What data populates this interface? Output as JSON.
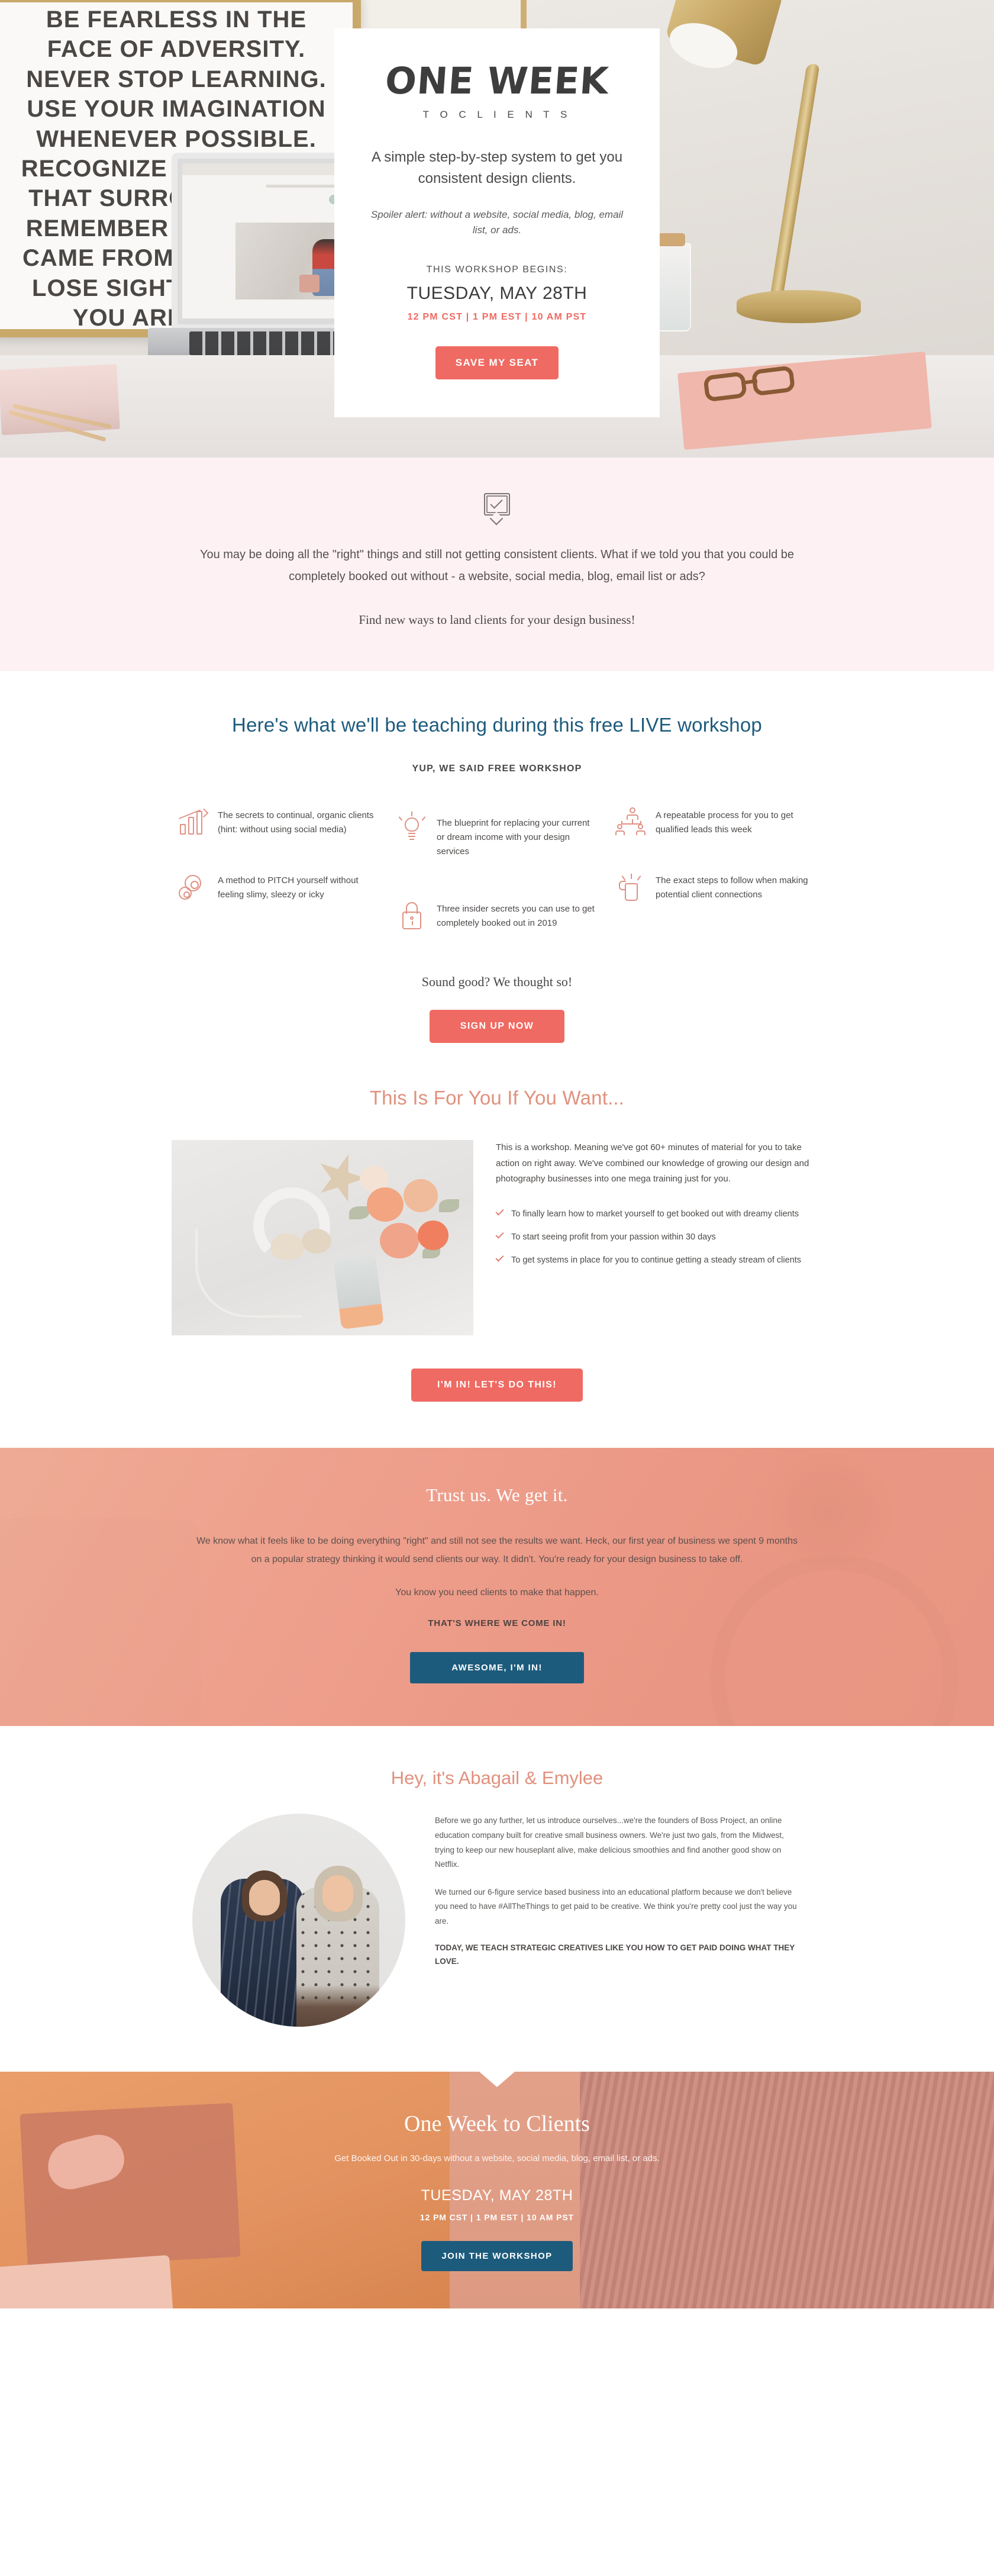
{
  "hero": {
    "poster_quote": "BE FEARLESS IN THE\nFACE OF ADVERSITY.\nNEVER STOP LEARNING.\nUSE YOUR IMAGINATION\nWHENEVER POSSIBLE.\nRECOGNIZE THE BEAUTY\nTHAT SURROUNDS YOU.\nREMEMBER WHERE YOU\nCAME FROM, BUT NEVER\nLOSE SIGHT OF WHERE\nYOU ARE GOING.",
    "logo_main": "ONE WEEK",
    "logo_sub": "T O   C L I E N T S",
    "tagline": "A simple step-by-step system to get you consistent design clients.",
    "spoiler": "Spoiler alert: without a website, social media, blog, email list, or ads.",
    "begins_label": "THIS WORKSHOP BEGINS:",
    "date": "TUESDAY, MAY 28TH",
    "times": "12 PM CST  |  1 PM EST  |  10 AM PST",
    "cta_label": "SAVE MY SEAT"
  },
  "pink_intro": {
    "icon": "chat-check-icon",
    "lead": "You may be doing all the \"right\" things and still not getting consistent clients. What if we told you that you could be completely booked out without - a website, social media, blog, email list or ads?",
    "serif_line": "Find new ways to land clients for your design business!"
  },
  "teaching": {
    "heading": "Here's what we'll be teaching during this free LIVE workshop",
    "kicker": "YUP, WE SAID FREE WORKSHOP",
    "features": [
      {
        "icon": "chart-growth-icon",
        "text": "The secrets to continual, organic clients (hint: without using social media)"
      },
      {
        "icon": "lightbulb-icon",
        "text": "The blueprint for replacing your current or dream income with your design services"
      },
      {
        "icon": "people-network-icon",
        "text": "A repeatable process for you to get qualified leads this week"
      },
      {
        "icon": "gears-icon",
        "text": "A method to PITCH yourself without feeling slimy, sleezy or icky"
      },
      {
        "icon": "lock-icon",
        "text": "Three insider secrets you can use to get completely booked out in 2019"
      },
      {
        "icon": "thumbs-up-icon",
        "text": "The exact steps to follow when making potential client connections"
      }
    ],
    "sound_good": "Sound good? We thought so!",
    "cta_label": "SIGN UP NOW"
  },
  "for_you": {
    "heading": "This Is For You If You Want...",
    "photo_alt": "headphones-roses-phone-flatlay",
    "paragraph": "This is a workshop. Meaning we've got 60+ minutes of material for you to take action on right away. We've combined our knowledge of growing our design and photography businesses into one mega training just for you.",
    "bullets": [
      "To finally learn how to market yourself to get booked out with dreamy clients",
      "To start seeing profit from your passion within 30 days",
      "To get systems in place for you to continue getting a steady stream of clients"
    ],
    "cta_label": "I'M IN! LET'S DO THIS!"
  },
  "trust": {
    "heading": "Trust us. We get it.",
    "body": "We know what it feels like to be doing everything \"right\" and still not see the results we want. Heck, our first year of business we spent 9 months on a popular strategy thinking it would send clients our way. It didn't. You're ready for your design business to take off.",
    "need_line": "You know you need clients to make that happen.",
    "where_line": "THAT'S WHERE WE COME IN!",
    "cta_label": "AWESOME, I'M IN!"
  },
  "bio": {
    "heading": "Hey, it's Abagail & Emylee",
    "photo_alt": "abagail-and-emylee-portrait",
    "paragraph1": "Before we go any further, let us introduce ourselves...we're the founders of Boss Project, an online education company built for creative small business owners. We're just two gals, from the Midwest, trying to keep our new houseplant alive, make delicious smoothies and find another good show on Netflix.",
    "paragraph2": "We turned our 6-figure service based business into an educational platform because we don't believe you need to have #AllTheThings to get paid to be creative. We think you're pretty cool just the way you are.",
    "paragraph3": "TODAY, WE TEACH STRATEGIC CREATIVES LIKE YOU HOW TO GET PAID DOING WHAT THEY LOVE."
  },
  "footer_cta": {
    "heading": "One Week to Clients",
    "subheading": "Get Booked Out in 30-days without a website, social media, blog, email list, or ads.",
    "date": "TUESDAY, MAY 28TH",
    "times": "12 PM CST | 1 PM EST | 10 AM PST",
    "cta_label": "JOIN THE WORKSHOP"
  },
  "colors": {
    "coral": "#ef6a62",
    "navy": "#1d5b7c",
    "salmon": "#e0917e",
    "pink_bg": "#fdf1f3",
    "trust_bg": "#ea9684"
  }
}
